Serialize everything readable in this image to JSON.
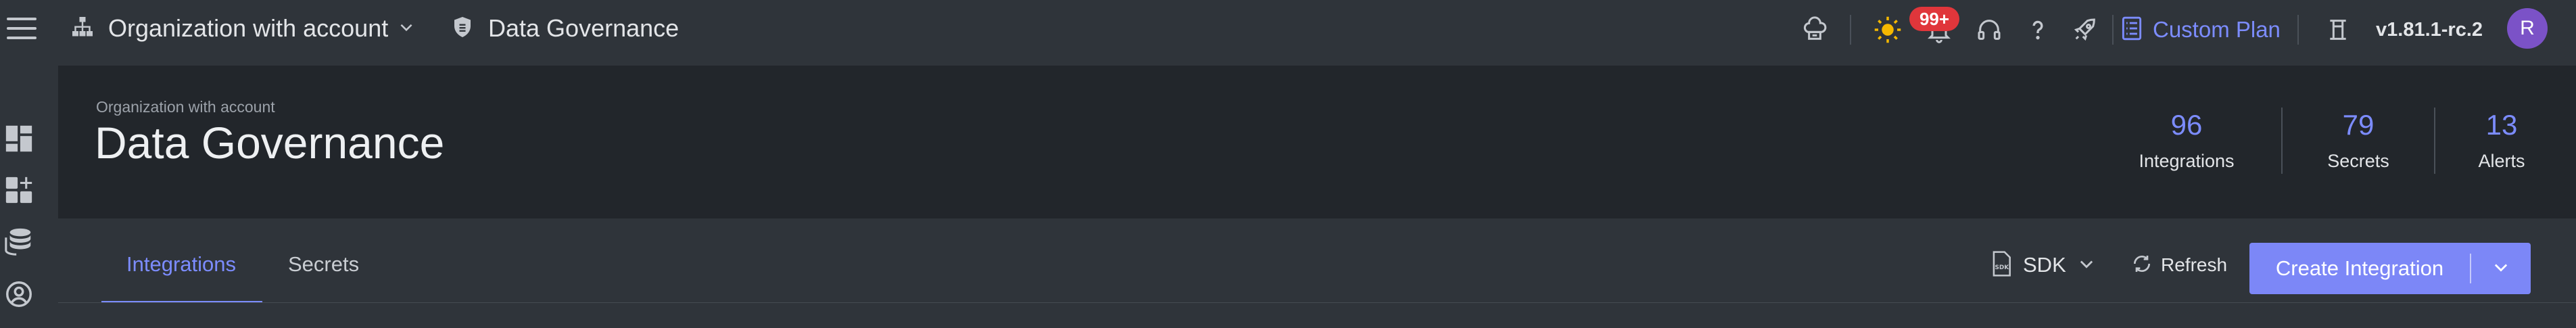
{
  "topbar": {
    "org_name": "Organization with account",
    "breadcrumb": "Data Governance",
    "notifications_badge": "99+",
    "plan_label": "Custom Plan",
    "version": "v1.81.1-rc.2",
    "avatar_initial": "R",
    "icons": [
      "menu-icon",
      "org-tree-icon",
      "chevron-down-icon",
      "shield-icon",
      "cloud-chef-icon",
      "sun-icon",
      "bell-icon",
      "headset-icon",
      "help-icon",
      "rocket-icon",
      "plan-list-icon",
      "changelog-icon"
    ]
  },
  "sidebar": {
    "icons": [
      "dashboard-icon",
      "add-widget-icon",
      "database-icon",
      "settings-icon"
    ]
  },
  "header": {
    "subtitle": "Organization with account",
    "title": "Data Governance",
    "stats": [
      {
        "value": "96",
        "label": "Integrations"
      },
      {
        "value": "79",
        "label": "Secrets"
      },
      {
        "value": "13",
        "label": "Alerts"
      }
    ]
  },
  "tabs": [
    {
      "label": "Integrations",
      "active": true
    },
    {
      "label": "Secrets",
      "active": false
    }
  ],
  "toolbar": {
    "sdk_label": "SDK",
    "refresh_label": "Refresh",
    "create_label": "Create Integration"
  },
  "colors": {
    "accent": "#7c8cff",
    "button": "#7c87f7",
    "badge": "#e0363b",
    "avatar": "#7b52c7",
    "topbar_bg": "#2f343a",
    "header_bg": "#22262b"
  }
}
